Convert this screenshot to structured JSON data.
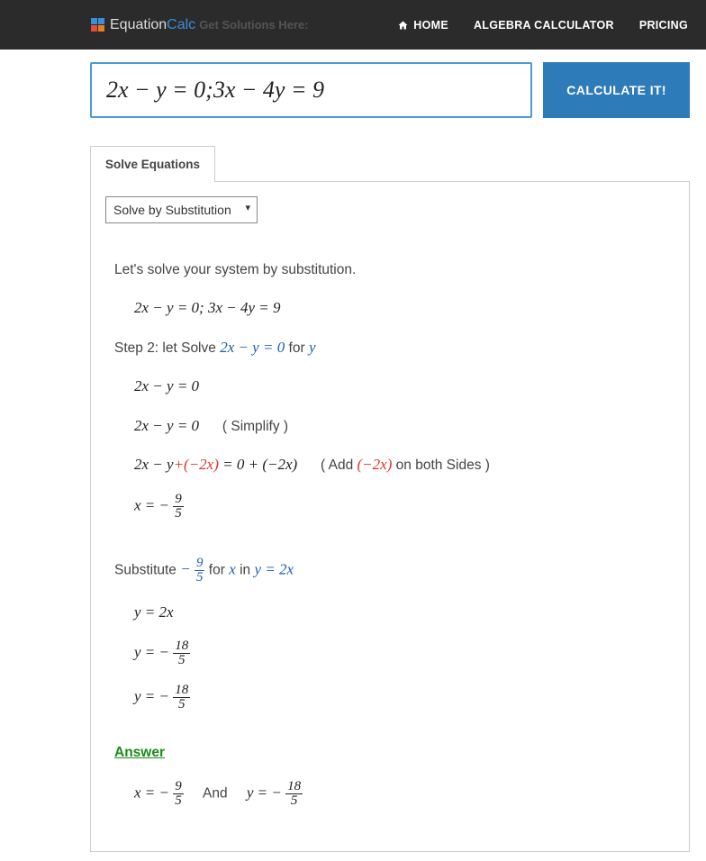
{
  "nav": {
    "logo_part1": "Equation",
    "logo_part2": "Calc",
    "tagline": "Get Solutions Here:",
    "home": "HOME",
    "algebra": "ALGEBRA CALCULATOR",
    "pricing": "PRICING"
  },
  "input": {
    "equation": "2x − y = 0;3x − 4y = 9",
    "button": "CALCULATE IT!"
  },
  "tab": {
    "label": "Solve Equations"
  },
  "select": {
    "value": "Solve by Substitution"
  },
  "solution": {
    "intro": "Let's solve your system by substitution.",
    "system": "2x − y = 0;   3x − 4y = 9",
    "step2_pre": "Step 2: let Solve ",
    "step2_eq": "2x − y = 0",
    "step2_mid": " for ",
    "step2_var": "y",
    "line1": "2x − y = 0",
    "line2_eq": "2x − y = 0",
    "line2_note": "( Simplify )",
    "line3_l": "2x − y",
    "line3_add": "+(−2x)",
    "line3_r": " = 0 + (−2x)",
    "line3_note_pre": "( Add  ",
    "line3_note_red": "(−2x)",
    "line3_note_post": "  on both Sides )",
    "line4_pre": "x = − ",
    "line4_num": "9",
    "line4_den": "5",
    "sub_pre": "Substitute ",
    "sub_mid1": " for ",
    "sub_x": "x",
    "sub_mid2": " in ",
    "sub_eq": "y = 2x",
    "sub_frac_num": "9",
    "sub_frac_den": "5",
    "y1": "y = 2x",
    "y2_pre": "y = − ",
    "y2_num": "18",
    "y2_den": "5",
    "y3_pre": "y = − ",
    "y3_num": "18",
    "y3_den": "5",
    "answer_label": "Answer",
    "ans_x_pre": "x = − ",
    "ans_x_num": "9",
    "ans_x_den": "5",
    "ans_and": "And",
    "ans_y_pre": "y = − ",
    "ans_y_num": "18",
    "ans_y_den": "5"
  }
}
